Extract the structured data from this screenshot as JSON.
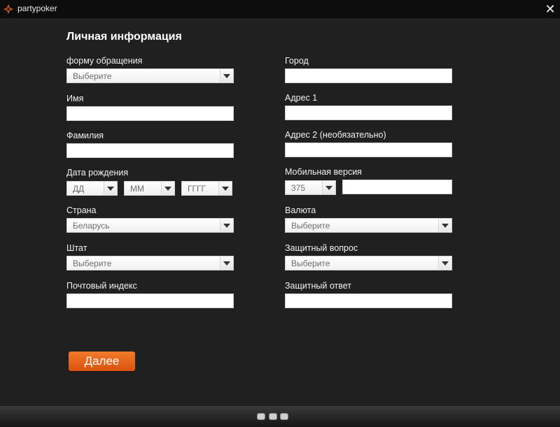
{
  "window": {
    "title": "partypoker",
    "icon": "partypoker-logo-icon",
    "close_icon": "close-icon"
  },
  "form": {
    "title": "Личная информация",
    "salutation": {
      "label": "форму обращения",
      "value": "Выберите"
    },
    "first_name": {
      "label": "Имя",
      "value": ""
    },
    "last_name": {
      "label": "Фамилия",
      "value": ""
    },
    "birth_date": {
      "label": "Дата рождения",
      "day": "ДД",
      "month": "ММ",
      "year": "ГГГГ"
    },
    "country": {
      "label": "Страна",
      "value": "Беларусь"
    },
    "state": {
      "label": "Штат",
      "value": "Выберите"
    },
    "postal_code": {
      "label": "Почтовый индекс",
      "value": ""
    },
    "city": {
      "label": "Город",
      "value": ""
    },
    "address1": {
      "label": "Адрес 1",
      "value": ""
    },
    "address2": {
      "label": "Адрес 2 (необязательно)",
      "value": ""
    },
    "mobile": {
      "label": "Мобильная версия",
      "code": "375",
      "number": ""
    },
    "currency": {
      "label": "Валюта",
      "value": "Выберите"
    },
    "security_question": {
      "label": "Защитный вопрос",
      "value": "Выберите"
    },
    "security_answer": {
      "label": "Защитный ответ",
      "value": ""
    },
    "next_button": "Далее"
  },
  "pagination": {
    "pages": 3
  },
  "colors": {
    "accent": "#e8621c",
    "background": "#202020",
    "titlebar": "#0d0d0d"
  }
}
